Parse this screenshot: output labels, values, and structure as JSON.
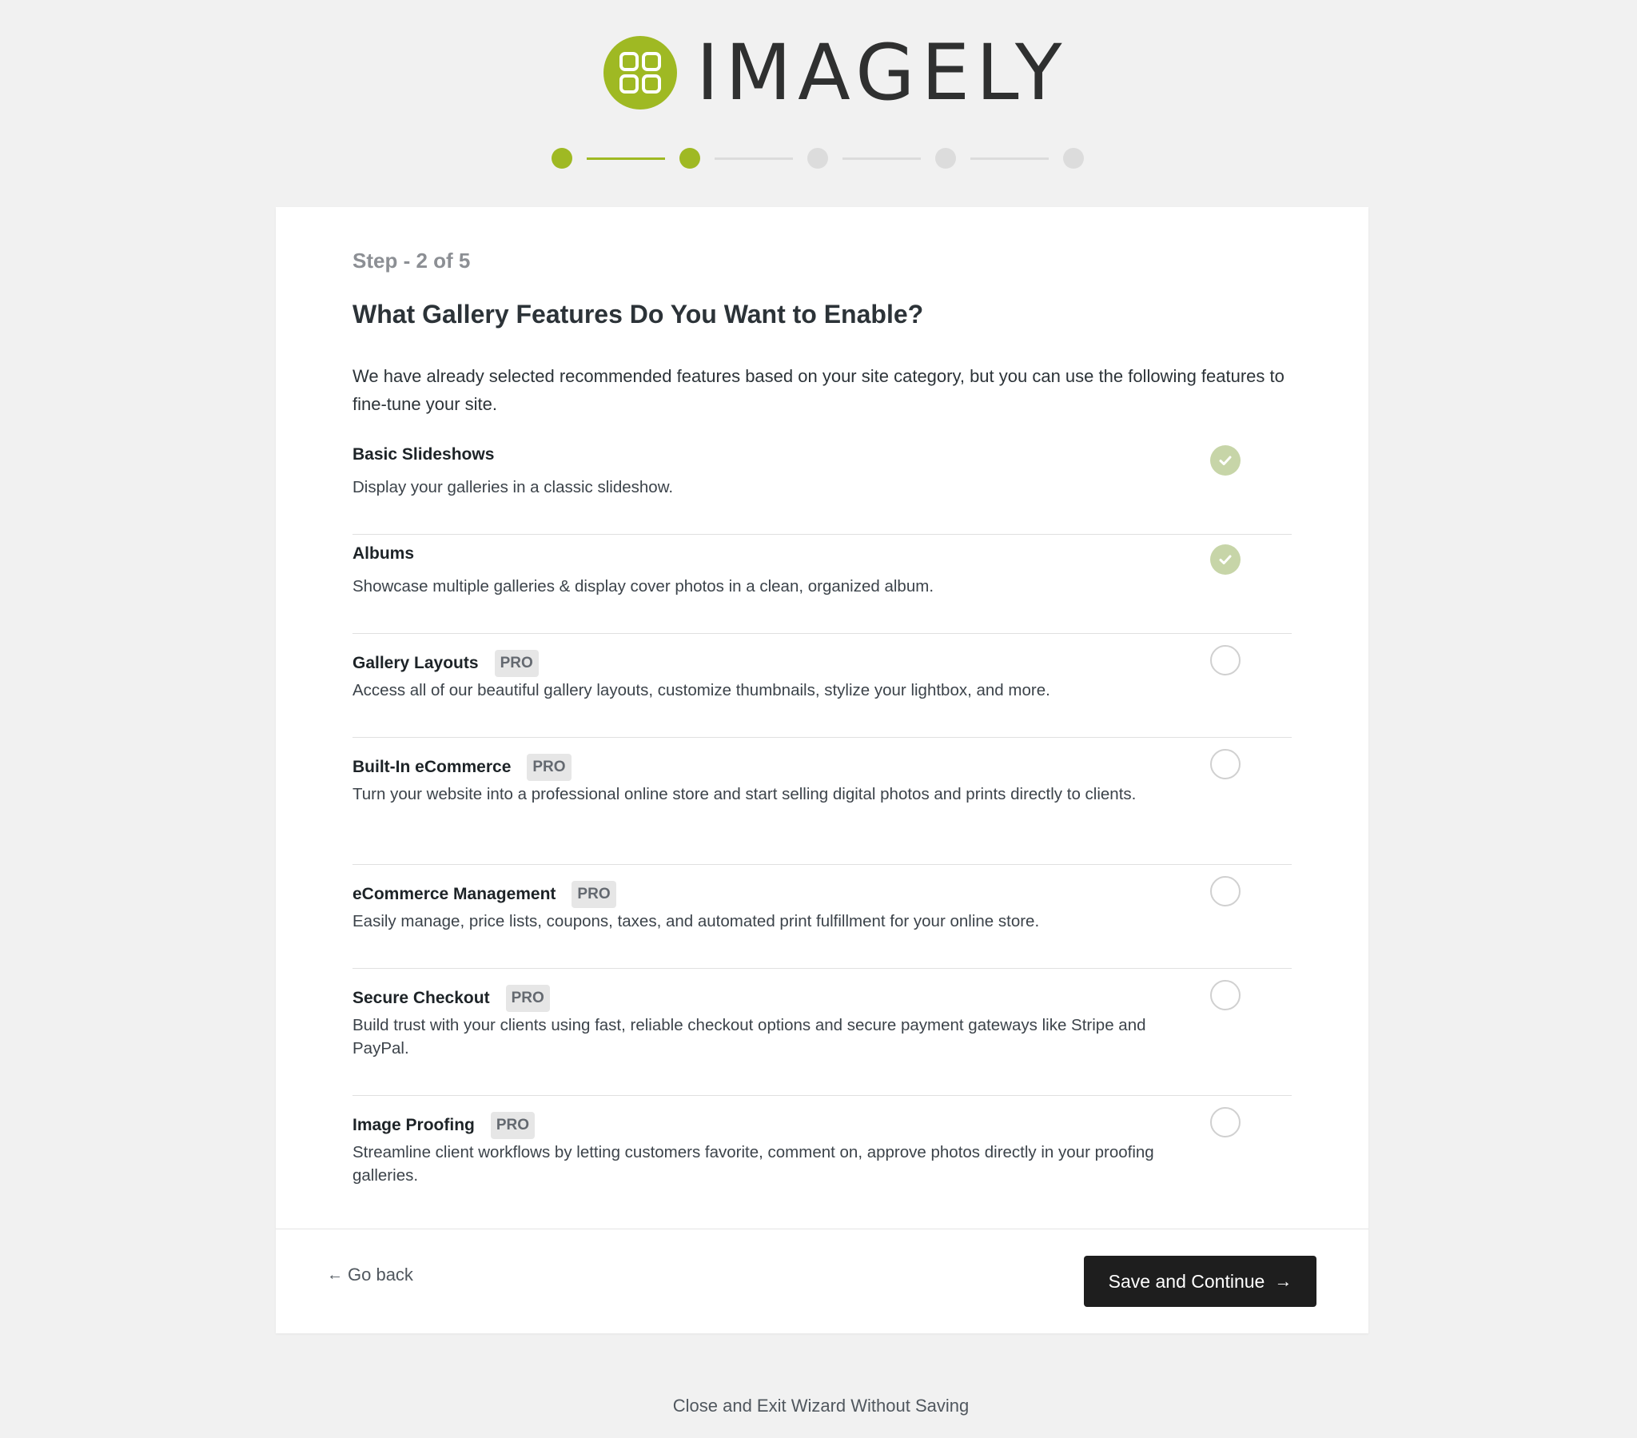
{
  "brand": {
    "name": "IMAGELY",
    "color": "#9fb923"
  },
  "wizard": {
    "current_step": 2,
    "total_steps": 5,
    "step_label": "Step - 2 of 5"
  },
  "main": {
    "title": "What Gallery Features Do You Want to Enable?",
    "intro": "We have already selected recommended features based on your site category, but you can use the following features to fine-tune your site."
  },
  "features": [
    {
      "title": "Basic Slideshows",
      "description": "Display your galleries in a classic slideshow.",
      "pro": false,
      "checked": true
    },
    {
      "title": "Albums",
      "description": "Showcase multiple galleries & display cover photos in a clean, organized album.",
      "pro": false,
      "checked": true
    },
    {
      "title": "Gallery Layouts",
      "description": "Access all of our beautiful gallery layouts, customize thumbnails, stylize your lightbox, and more.",
      "pro": true,
      "checked": false
    },
    {
      "title": "Built-In eCommerce",
      "description": "Turn your website into a professional online store and start selling digital photos and prints directly to clients.",
      "pro": true,
      "checked": false
    },
    {
      "title": "eCommerce Management",
      "description": "Easily manage, price lists, coupons, taxes, and automated print fulfillment for your online store.",
      "pro": true,
      "checked": false
    },
    {
      "title": "Secure Checkout",
      "description": "Build trust with your clients using fast, reliable checkout options and secure payment gateways like Stripe and PayPal.",
      "pro": true,
      "checked": false
    },
    {
      "title": "Image Proofing",
      "description": "Streamline client workflows by letting customers favorite, comment on, approve photos directly in your proofing galleries.",
      "pro": true,
      "checked": false
    }
  ],
  "pro_badge_label": "PRO",
  "footer": {
    "back_label": "Go back",
    "back_icon": "arrow-left-icon",
    "save_label": "Save and Continue",
    "save_icon": "arrow-right-icon",
    "exit_label": "Close and Exit Wizard Without Saving"
  }
}
